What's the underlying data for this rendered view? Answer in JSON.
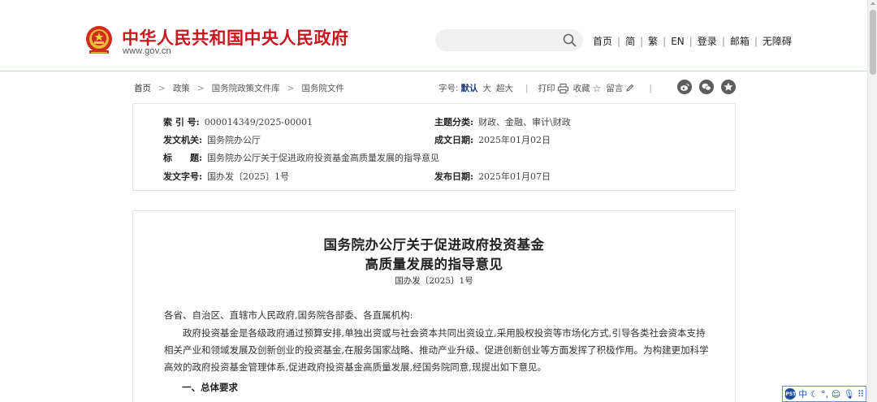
{
  "header": {
    "site_name": "中华人民共和国中央人民政府",
    "site_url": "www.gov.cn",
    "nav": [
      "首页",
      "简",
      "繁",
      "EN",
      "登录",
      "邮箱",
      "无障碍"
    ]
  },
  "breadcrumb": [
    "首页",
    "政策",
    "国务院政策文件库",
    "国务院文件"
  ],
  "tools": {
    "font_label": "字号:",
    "font_default": "默认",
    "font_large": "大",
    "font_xlarge": "超大",
    "print": "打印",
    "favorite": "收藏",
    "comment": "留言"
  },
  "info": {
    "index_label": "索 引 号:",
    "index_value": "000014349/2025-00001",
    "category_label": "主题分类:",
    "category_value": "财政、金融、审计\\财政",
    "issuer_label": "发文机关:",
    "issuer_value": "国务院办公厅",
    "created_label": "成文日期:",
    "created_value": "2025年01月02日",
    "title_label": "标　　题:",
    "title_value": "国务院办公厅关于促进政府投资基金高质量发展的指导意见",
    "docnum_label": "发文字号:",
    "docnum_value": "国办发〔2025〕1号",
    "published_label": "发布日期:",
    "published_value": "2025年01月07日"
  },
  "article": {
    "title_line1": "国务院办公厅关于促进政府投资基金",
    "title_line2": "高质量发展的指导意见",
    "doc_number": "国办发〔2025〕1号",
    "salutation": "各省、自治区、直辖市人民政府,国务院各部委、各直属机构:",
    "para1": "政府投资基金是各级政府通过预算安排,单独出资或与社会资本共同出资设立,采用股权投资等市场化方式,引导各类社会资本支持相关产业和领域发展及创新创业的投资基金,在服务国家战略、推动产业升级、促进创新创业等方面发挥了积极作用。为构建更加科学高效的政府投资基金管理体系,促进政府投资基金高质量发展,经国务院同意,现提出如下意见。",
    "section1": "一、总体要求"
  },
  "ime": {
    "lang": "中"
  },
  "colors": {
    "brand_red": "#c8171e",
    "accent_blue": "#1f3b7a"
  }
}
